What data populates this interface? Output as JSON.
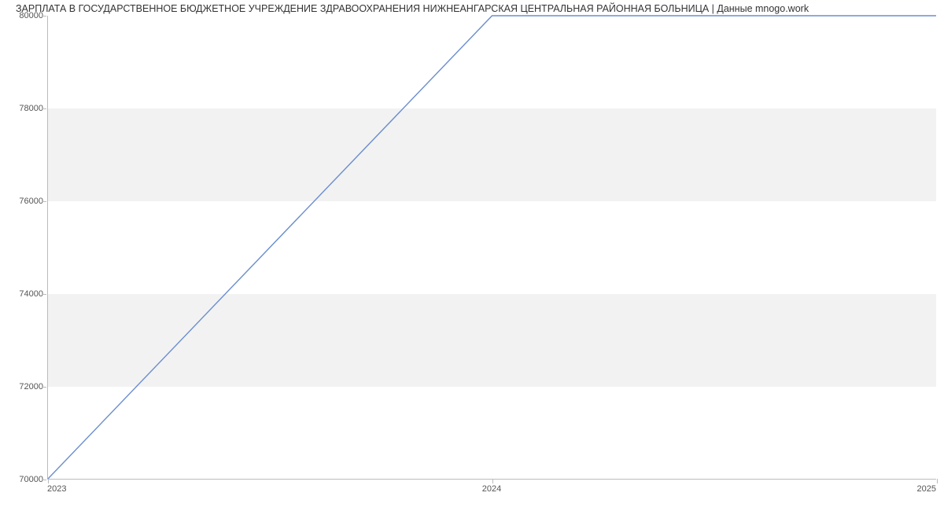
{
  "chart_data": {
    "type": "line",
    "title": "ЗАРПЛАТА В ГОСУДАРСТВЕННОЕ БЮДЖЕТНОЕ УЧРЕЖДЕНИЕ ЗДРАВООХРАНЕНИЯ НИЖНЕАНГАРСКАЯ ЦЕНТРАЛЬНАЯ РАЙОННАЯ БОЛЬНИЦА | Данные mnogo.work",
    "xlabel": "",
    "ylabel": "",
    "x": [
      2023,
      2024,
      2025
    ],
    "values": [
      70000,
      80000,
      80000
    ],
    "x_ticks": [
      2023,
      2024,
      2025
    ],
    "y_ticks": [
      70000,
      72000,
      74000,
      76000,
      78000,
      80000
    ],
    "xlim": [
      2023,
      2025
    ],
    "ylim": [
      70000,
      80000
    ],
    "bands": [
      [
        72000,
        74000
      ],
      [
        76000,
        78000
      ]
    ],
    "line_color": "#6b8ecf"
  }
}
